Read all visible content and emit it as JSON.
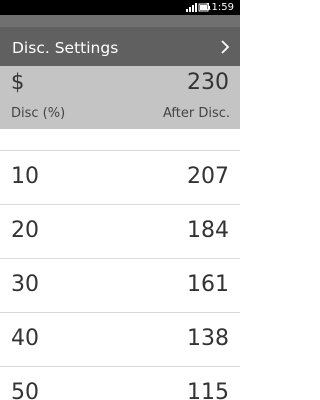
{
  "status_bar": {
    "icons": [
      "signal-icon",
      "battery-icon"
    ],
    "time": "11:59"
  },
  "header": {
    "settings_label": "Disc. Settings",
    "chevron": ">"
  },
  "price_panel": {
    "currency_symbol": "$",
    "price": "230",
    "disc_label": "Disc (%)",
    "after_label": "After Disc."
  },
  "results": [
    {
      "percent": "10",
      "price": "207"
    },
    {
      "percent": "20",
      "price": "184"
    },
    {
      "percent": "30",
      "price": "161"
    },
    {
      "percent": "40",
      "price": "138"
    },
    {
      "percent": "50",
      "price": "115"
    }
  ],
  "colors": {
    "status_bar": "#000000",
    "header": "#606060",
    "header_strip": "#707070",
    "price_panel": "#c4c4c4",
    "text_dark": "#333333",
    "text_light": "#ffffff",
    "divider": "#d9d9d9"
  }
}
